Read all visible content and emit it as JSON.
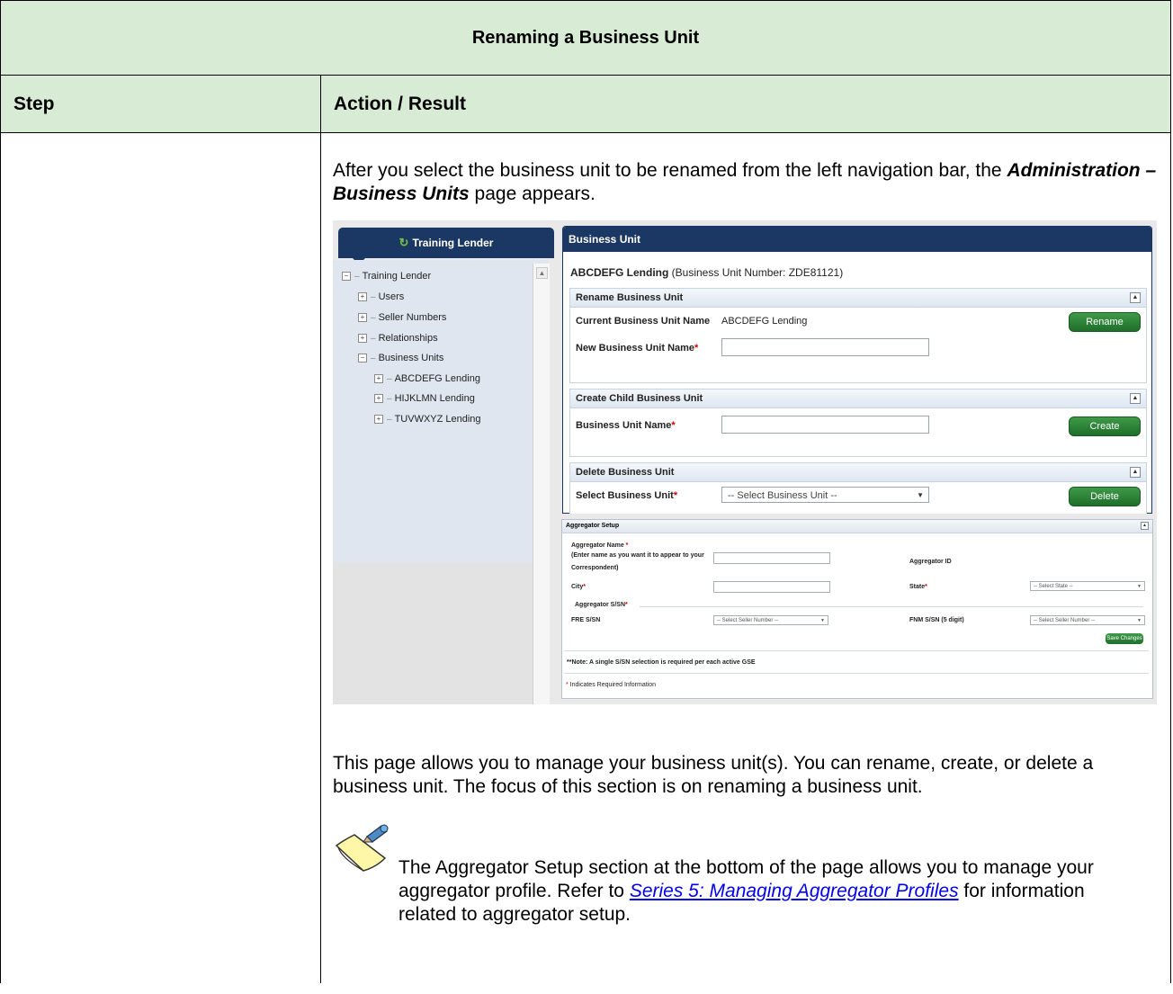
{
  "document": {
    "title": "Renaming a Business Unit",
    "col_step": "Step",
    "col_action": "Action / Result",
    "intro_prefix": "After you select the business unit to be renamed from the left navigation bar, the ",
    "intro_emph": "Administration – Business Units",
    "intro_suffix": " page appears.",
    "outro": "This page allows you to manage your business unit(s).  You can rename, create, or delete a business unit.  The focus of this section is on renaming a business unit.",
    "note_prefix": " The Aggregator Setup section at the bottom of the page allows you to manage your aggregator profile. Refer to ",
    "note_link": "Series 5: Managing Aggregator Profiles",
    "note_suffix": " for information related to aggregator setup."
  },
  "screenshot": {
    "nav": {
      "header": "Training Lender",
      "root": "Training Lender",
      "items": [
        "Users",
        "Seller Numbers",
        "Relationships",
        "Business Units"
      ],
      "children": [
        "ABCDEFG Lending",
        "HIJKLMN Lending",
        "TUVWXYZ Lending"
      ]
    },
    "panel": {
      "header": "Business Unit",
      "bu_name": "ABCDEFG Lending",
      "bu_number_text": "(Business Unit Number: ZDE81121)",
      "rename": {
        "title": "Rename Business Unit",
        "current_label": "Current Business Unit Name",
        "current_value": "ABCDEFG Lending",
        "new_label": "New Business Unit Name",
        "button": "Rename"
      },
      "create": {
        "title": "Create Child Business Unit",
        "name_label": "Business Unit Name",
        "button": "Create"
      },
      "delete": {
        "title": "Delete Business Unit",
        "select_label": "Select Business Unit",
        "select_value": "-- Select Business Unit --",
        "button": "Delete"
      }
    },
    "aggregator": {
      "title": "Aggregator Setup",
      "name_label": "Aggregator Name",
      "name_hint": "(Enter name as you want it to appear to your",
      "name_hint2": "Correspondent)",
      "id_label": "Aggregator ID",
      "city_label": "City",
      "state_label": "State",
      "state_value": "-- Select State --",
      "ssn_label": "Aggregator S/SN",
      "fre_label": "FRE S/SN",
      "fre_value": "-- Select Seller Number --",
      "fnm_label": "FNM S/SN (5 digit)",
      "fnm_value": "-- Select Seller Number --",
      "save_button": "Save Changes",
      "note": "**Note: A single S/SN selection is required per each active GSE",
      "required_note": "Indicates Required Information"
    }
  }
}
